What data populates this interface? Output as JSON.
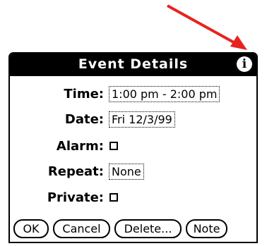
{
  "dialog": {
    "title": "Event Details",
    "info_icon": "info-icon"
  },
  "fields": {
    "time": {
      "label": "Time:",
      "value": "1:00 pm - 2:00 pm"
    },
    "date": {
      "label": "Date:",
      "value": "Fri 12/3/99"
    },
    "alarm": {
      "label": "Alarm:",
      "checked": false
    },
    "repeat": {
      "label": "Repeat:",
      "value": "None"
    },
    "private": {
      "label": "Private:",
      "checked": false
    }
  },
  "buttons": {
    "ok": "OK",
    "cancel": "Cancel",
    "delete": "Delete...",
    "note": "Note"
  },
  "colors": {
    "annotation_arrow": "#e8231f",
    "titlebar": "#000000"
  }
}
